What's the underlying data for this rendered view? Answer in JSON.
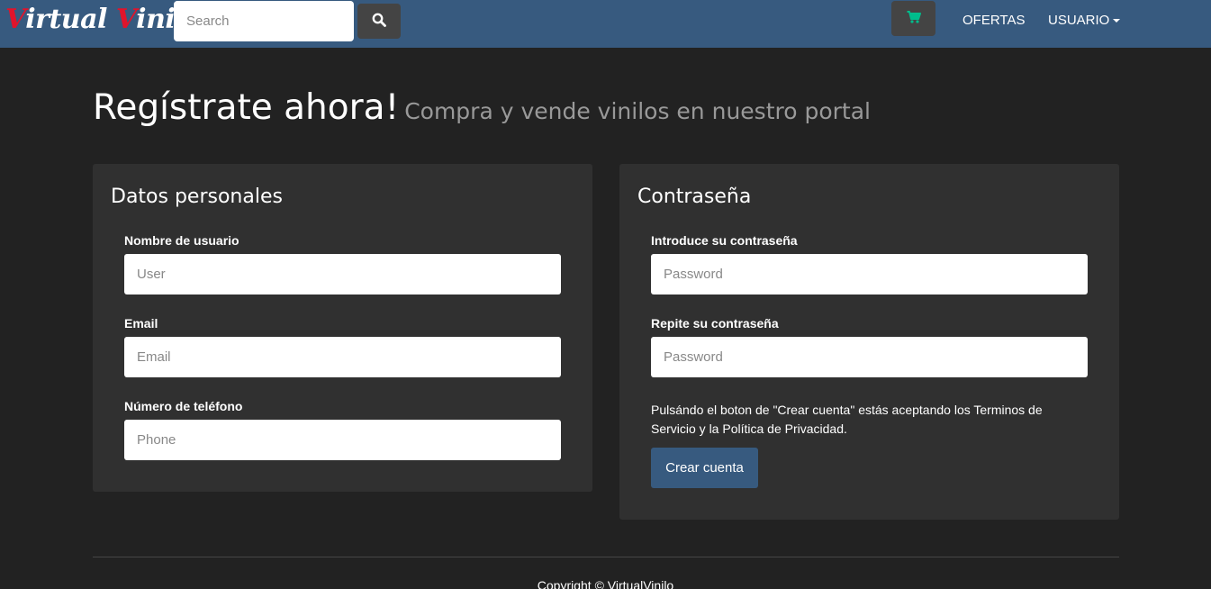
{
  "navbar": {
    "brand_first_initial": "V",
    "brand_first_rest": "irtual",
    "brand_second_initial": "V",
    "brand_second_rest": "inilo",
    "search_placeholder": "Search",
    "search_icon": "search-icon",
    "cart_icon": "cart-icon",
    "links": {
      "ofertas": "OFERTAS",
      "usuario": "USUARIO"
    }
  },
  "header": {
    "title": "Regístrate ahora!",
    "subtitle": "Compra y vende vinilos en nuestro portal"
  },
  "personal": {
    "title": "Datos personales",
    "username_label": "Nombre de usuario",
    "username_placeholder": "User",
    "email_label": "Email",
    "email_placeholder": "Email",
    "phone_label": "Número de teléfono",
    "phone_placeholder": "Phone"
  },
  "password": {
    "title": "Contraseña",
    "password_label": "Introduce su contraseña",
    "password_placeholder": "Password",
    "repeat_label": "Repite su contraseña",
    "repeat_placeholder": "Password",
    "terms_text": "Pulsándo el boton de \"Crear cuenta\" estás aceptando los Terminos de Servicio y la Política de Privacidad.",
    "submit_label": "Crear cuenta"
  },
  "footer": {
    "copyright": "Copyright © VirtualVinilo"
  },
  "colors": {
    "background": "#222222",
    "navbar": "#375a7f",
    "panel": "#303030",
    "brand_accent": "#e0142c",
    "cart_icon": "#00bc8c",
    "button": "#375a7f"
  }
}
